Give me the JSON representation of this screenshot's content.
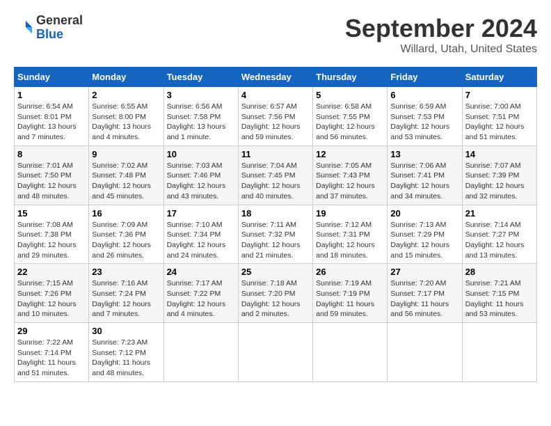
{
  "logo": {
    "line1": "General",
    "line2": "Blue"
  },
  "title": "September 2024",
  "location": "Willard, Utah, United States",
  "days_of_week": [
    "Sunday",
    "Monday",
    "Tuesday",
    "Wednesday",
    "Thursday",
    "Friday",
    "Saturday"
  ],
  "weeks": [
    [
      {
        "day": "1",
        "info": "Sunrise: 6:54 AM\nSunset: 8:01 PM\nDaylight: 13 hours\nand 7 minutes."
      },
      {
        "day": "2",
        "info": "Sunrise: 6:55 AM\nSunset: 8:00 PM\nDaylight: 13 hours\nand 4 minutes."
      },
      {
        "day": "3",
        "info": "Sunrise: 6:56 AM\nSunset: 7:58 PM\nDaylight: 13 hours\nand 1 minute."
      },
      {
        "day": "4",
        "info": "Sunrise: 6:57 AM\nSunset: 7:56 PM\nDaylight: 12 hours\nand 59 minutes."
      },
      {
        "day": "5",
        "info": "Sunrise: 6:58 AM\nSunset: 7:55 PM\nDaylight: 12 hours\nand 56 minutes."
      },
      {
        "day": "6",
        "info": "Sunrise: 6:59 AM\nSunset: 7:53 PM\nDaylight: 12 hours\nand 53 minutes."
      },
      {
        "day": "7",
        "info": "Sunrise: 7:00 AM\nSunset: 7:51 PM\nDaylight: 12 hours\nand 51 minutes."
      }
    ],
    [
      {
        "day": "8",
        "info": "Sunrise: 7:01 AM\nSunset: 7:50 PM\nDaylight: 12 hours\nand 48 minutes."
      },
      {
        "day": "9",
        "info": "Sunrise: 7:02 AM\nSunset: 7:48 PM\nDaylight: 12 hours\nand 45 minutes."
      },
      {
        "day": "10",
        "info": "Sunrise: 7:03 AM\nSunset: 7:46 PM\nDaylight: 12 hours\nand 43 minutes."
      },
      {
        "day": "11",
        "info": "Sunrise: 7:04 AM\nSunset: 7:45 PM\nDaylight: 12 hours\nand 40 minutes."
      },
      {
        "day": "12",
        "info": "Sunrise: 7:05 AM\nSunset: 7:43 PM\nDaylight: 12 hours\nand 37 minutes."
      },
      {
        "day": "13",
        "info": "Sunrise: 7:06 AM\nSunset: 7:41 PM\nDaylight: 12 hours\nand 34 minutes."
      },
      {
        "day": "14",
        "info": "Sunrise: 7:07 AM\nSunset: 7:39 PM\nDaylight: 12 hours\nand 32 minutes."
      }
    ],
    [
      {
        "day": "15",
        "info": "Sunrise: 7:08 AM\nSunset: 7:38 PM\nDaylight: 12 hours\nand 29 minutes."
      },
      {
        "day": "16",
        "info": "Sunrise: 7:09 AM\nSunset: 7:36 PM\nDaylight: 12 hours\nand 26 minutes."
      },
      {
        "day": "17",
        "info": "Sunrise: 7:10 AM\nSunset: 7:34 PM\nDaylight: 12 hours\nand 24 minutes."
      },
      {
        "day": "18",
        "info": "Sunrise: 7:11 AM\nSunset: 7:32 PM\nDaylight: 12 hours\nand 21 minutes."
      },
      {
        "day": "19",
        "info": "Sunrise: 7:12 AM\nSunset: 7:31 PM\nDaylight: 12 hours\nand 18 minutes."
      },
      {
        "day": "20",
        "info": "Sunrise: 7:13 AM\nSunset: 7:29 PM\nDaylight: 12 hours\nand 15 minutes."
      },
      {
        "day": "21",
        "info": "Sunrise: 7:14 AM\nSunset: 7:27 PM\nDaylight: 12 hours\nand 13 minutes."
      }
    ],
    [
      {
        "day": "22",
        "info": "Sunrise: 7:15 AM\nSunset: 7:26 PM\nDaylight: 12 hours\nand 10 minutes."
      },
      {
        "day": "23",
        "info": "Sunrise: 7:16 AM\nSunset: 7:24 PM\nDaylight: 12 hours\nand 7 minutes."
      },
      {
        "day": "24",
        "info": "Sunrise: 7:17 AM\nSunset: 7:22 PM\nDaylight: 12 hours\nand 4 minutes."
      },
      {
        "day": "25",
        "info": "Sunrise: 7:18 AM\nSunset: 7:20 PM\nDaylight: 12 hours\nand 2 minutes."
      },
      {
        "day": "26",
        "info": "Sunrise: 7:19 AM\nSunset: 7:19 PM\nDaylight: 11 hours\nand 59 minutes."
      },
      {
        "day": "27",
        "info": "Sunrise: 7:20 AM\nSunset: 7:17 PM\nDaylight: 11 hours\nand 56 minutes."
      },
      {
        "day": "28",
        "info": "Sunrise: 7:21 AM\nSunset: 7:15 PM\nDaylight: 11 hours\nand 53 minutes."
      }
    ],
    [
      {
        "day": "29",
        "info": "Sunrise: 7:22 AM\nSunset: 7:14 PM\nDaylight: 11 hours\nand 51 minutes."
      },
      {
        "day": "30",
        "info": "Sunrise: 7:23 AM\nSunset: 7:12 PM\nDaylight: 11 hours\nand 48 minutes."
      },
      {
        "day": "",
        "info": ""
      },
      {
        "day": "",
        "info": ""
      },
      {
        "day": "",
        "info": ""
      },
      {
        "day": "",
        "info": ""
      },
      {
        "day": "",
        "info": ""
      }
    ]
  ]
}
